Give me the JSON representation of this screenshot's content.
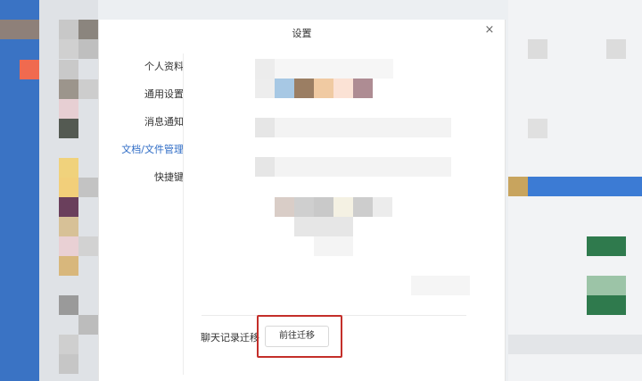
{
  "dialog": {
    "title": "设置",
    "close_icon": "close-icon",
    "close_glyph": "×"
  },
  "sidebar": {
    "items": [
      {
        "label": "个人资料",
        "active": false
      },
      {
        "label": "通用设置",
        "active": false
      },
      {
        "label": "消息通知",
        "active": false
      },
      {
        "label": "文档/文件管理",
        "active": true
      },
      {
        "label": "快捷键",
        "active": false
      }
    ]
  },
  "migration": {
    "label": "聊天记录迁移",
    "button_label": "前往迁移"
  },
  "colors": {
    "accent_active": "#2d6bc5",
    "highlight_border": "#c42f2a"
  }
}
